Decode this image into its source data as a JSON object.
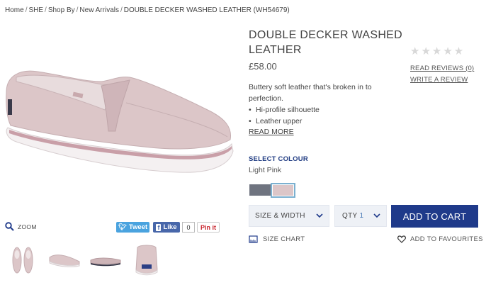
{
  "breadcrumb": {
    "items": [
      "Home",
      "SHE",
      "Shop By",
      "New Arrivals",
      "DOUBLE DECKER WASHED LEATHER (WH54679)"
    ],
    "separator": "/"
  },
  "product": {
    "title": "DOUBLE DECKER WASHED LEATHER",
    "price": "£58.00",
    "description": "Buttery soft leather that's broken in to perfection.",
    "features": [
      "Hi-profile silhouette",
      "Leather upper"
    ],
    "read_more": "READ MORE"
  },
  "rating": {
    "stars": "★★★★★",
    "value": 0,
    "max": 5,
    "reviews_link": "READ REVIEWS (0)",
    "write_review": "WRITE A REVIEW"
  },
  "colour": {
    "label": "SELECT COLOUR",
    "selected": "Light Pink",
    "swatches": [
      {
        "name": "grey",
        "color": "#6f7480"
      },
      {
        "name": "light-pink",
        "color": "#dcc6c8",
        "selected": true
      }
    ]
  },
  "options": {
    "size_width": "SIZE & WIDTH",
    "qty_label": "QTY",
    "qty_value": "1",
    "add_to_cart": "ADD TO CART",
    "size_chart": "SIZE CHART",
    "add_to_favourites": "ADD TO FAVOURITES"
  },
  "gallery": {
    "zoom": "ZOOM",
    "thumbnails": [
      "pair-top-view",
      "side-view",
      "side-view-2",
      "back-view"
    ]
  },
  "social": {
    "tweet": "Tweet",
    "like": "Like",
    "like_count": "0",
    "pinit": "Pin it"
  },
  "colors": {
    "accent": "#1f3a8a",
    "label_blue": "#1f3b82",
    "twitter": "#4aa3df",
    "facebook": "#4867aa",
    "pinterest": "#c8232c",
    "shoe_pink": "#dcc6c8"
  }
}
